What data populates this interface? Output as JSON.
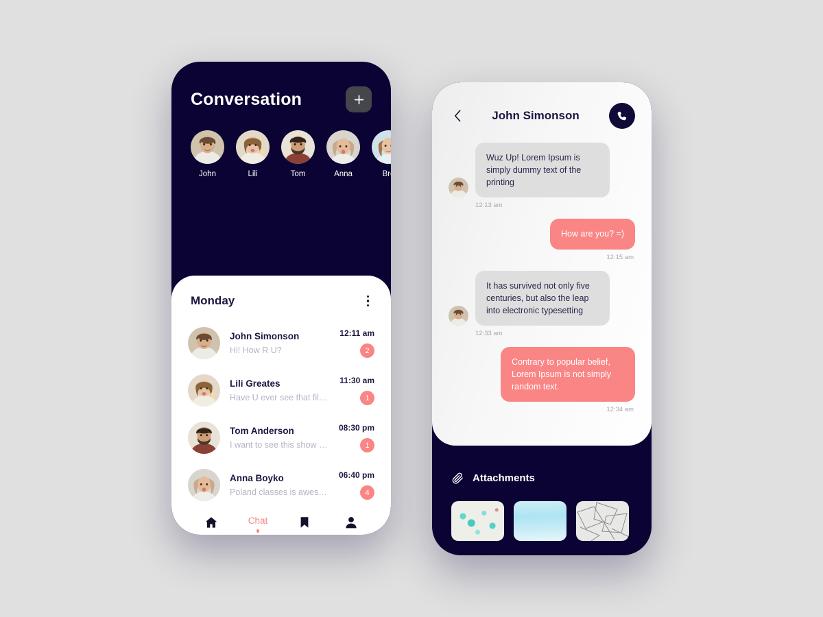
{
  "left_phone": {
    "header": {
      "title": "Conversation",
      "add_button_icon": "plus-icon"
    },
    "stories": [
      {
        "name": "John"
      },
      {
        "name": "Lili"
      },
      {
        "name": "Tom"
      },
      {
        "name": "Anna"
      },
      {
        "name": "Bre"
      }
    ],
    "card": {
      "day_label": "Monday",
      "menu_icon": "more-vertical-icon",
      "conversations": [
        {
          "name": "John Simonson",
          "message": "Hi! How R U?",
          "time": "12:11 am",
          "badge": "2"
        },
        {
          "name": "Lili Greates",
          "message": "Have U ever see that film?",
          "time": "11:30 am",
          "badge": "1"
        },
        {
          "name": "Tom Anderson",
          "message": "I want to see this show again",
          "time": "08:30 pm",
          "badge": "1"
        },
        {
          "name": "Anna Boyko",
          "message": "Poland classes is awesome!",
          "time": "06:40 pm",
          "badge": "4"
        }
      ]
    },
    "bottom_nav": [
      {
        "icon": "home-icon",
        "label": "",
        "active": false
      },
      {
        "icon": "",
        "label": "Chat",
        "active": true
      },
      {
        "icon": "bookmark-icon",
        "label": "",
        "active": false
      },
      {
        "icon": "person-icon",
        "label": "",
        "active": false
      }
    ]
  },
  "right_phone": {
    "header": {
      "back_icon": "chevron-left-icon",
      "contact_name": "John Simonson",
      "call_icon": "phone-icon"
    },
    "messages": [
      {
        "side": "in",
        "text": "Wuz Up! Lorem Ipsum is simply dummy text of the printing",
        "time": "12:13 am"
      },
      {
        "side": "out",
        "text": "How are you? =)",
        "time": "12:15 am"
      },
      {
        "side": "in",
        "text": "It has survived not only five centuries, but also the leap into electronic typesetting",
        "time": "12:33 am"
      },
      {
        "side": "out",
        "text": "Contrary to popular belief, Lorem Ipsum is not simply random text.",
        "time": "12:34 am"
      }
    ],
    "attachments": {
      "icon": "paperclip-icon",
      "title": "Attachments",
      "thumbs": [
        {
          "name": "teal-splatter-thumbnail"
        },
        {
          "name": "blue-gradient-thumbnail"
        },
        {
          "name": "geometric-lines-thumbnail"
        }
      ]
    }
  },
  "colors": {
    "page_background": "#E0E0E0",
    "phone_navy": "#0B0333",
    "accent_coral": "#FA8585",
    "bubble_gray": "#DEDEDE",
    "text_dark": "#1C1742",
    "text_muted": "#B6B4C4"
  }
}
